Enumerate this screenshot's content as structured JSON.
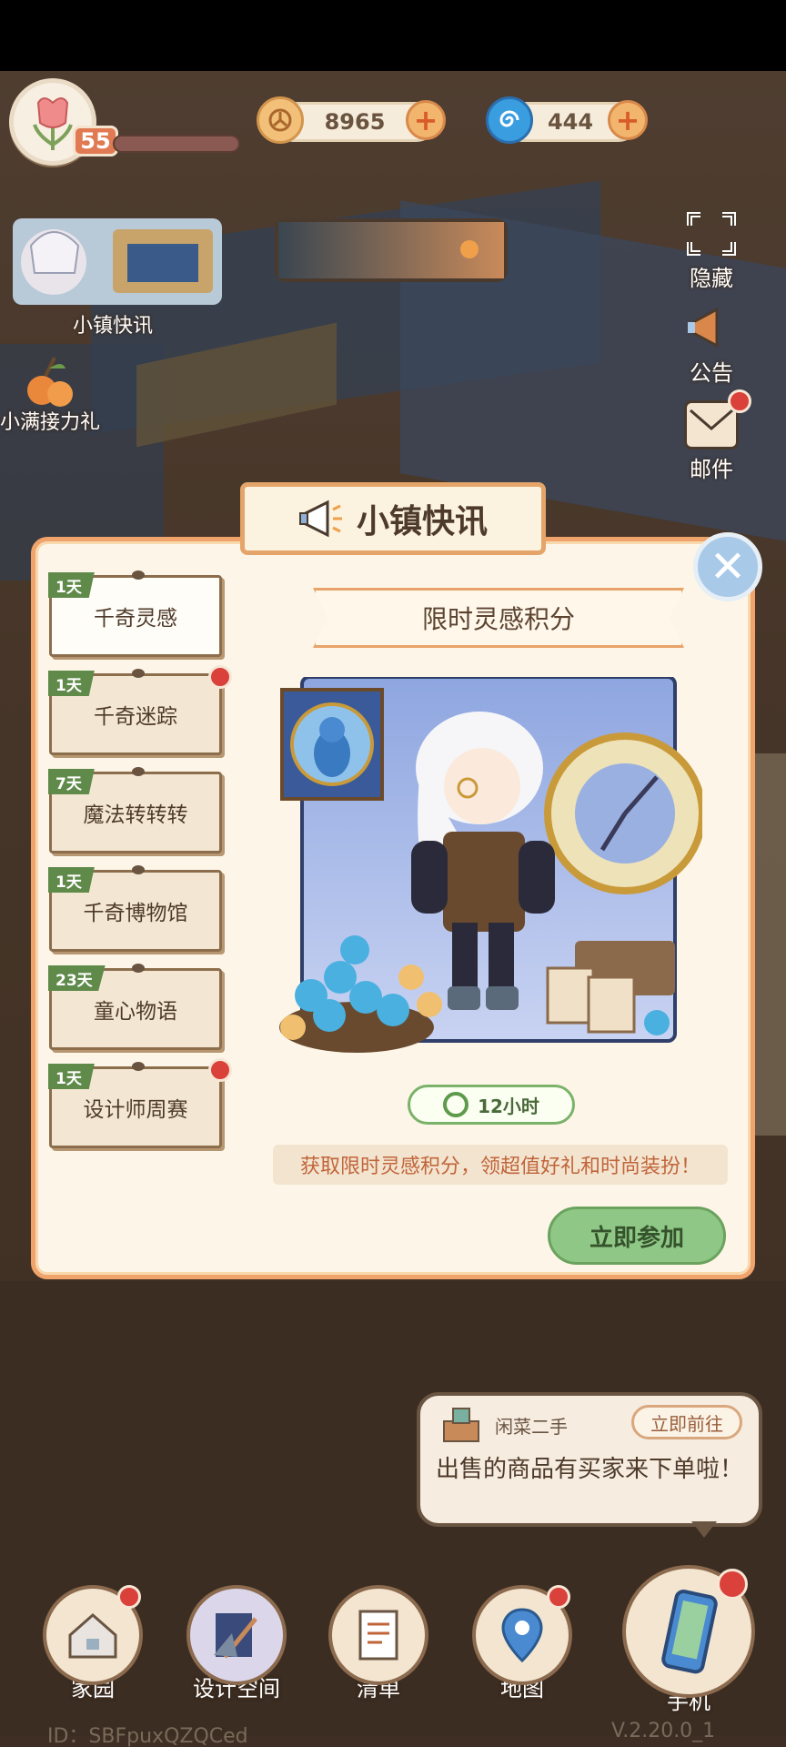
{
  "hud": {
    "level": "55",
    "coins": "8965",
    "gems": "444"
  },
  "left_shortcuts": {
    "news_label": "小镇快讯",
    "relay_label": "小满接力礼"
  },
  "right_rail": {
    "hide_label": "隐藏",
    "announce_label": "公告",
    "mail_label": "邮件"
  },
  "modal": {
    "title": "小镇快讯",
    "tabs": [
      {
        "days": "1天",
        "label": "千奇灵感",
        "active": true,
        "badge": false
      },
      {
        "days": "1天",
        "label": "千奇迷踪",
        "active": false,
        "badge": true
      },
      {
        "days": "7天",
        "label": "魔法转转转",
        "active": false,
        "badge": false
      },
      {
        "days": "1天",
        "label": "千奇博物馆",
        "active": false,
        "badge": false
      },
      {
        "days": "23天",
        "label": "童心物语",
        "active": false,
        "badge": false
      },
      {
        "days": "1天",
        "label": "设计师周赛",
        "active": false,
        "badge": true
      }
    ],
    "section_title": "限时灵感积分",
    "timer": "12小时",
    "description": "获取限时灵感积分，领超值好礼和时尚装扮！",
    "join_label": "立即参加"
  },
  "notification": {
    "app": "闲菜二手",
    "go_label": "立即前往",
    "message": "出售的商品有买家来下单啦！"
  },
  "bottom_nav": [
    {
      "label": "家园",
      "badge": true
    },
    {
      "label": "设计空间",
      "badge": false
    },
    {
      "label": "清单",
      "badge": false
    },
    {
      "label": "地图",
      "badge": true
    },
    {
      "label": "手机",
      "badge": true
    }
  ],
  "footer": {
    "id": "ID：SBFpuxQZQCed",
    "version": "V.2.20.0_1"
  },
  "colors": {
    "modal_border": "#f0a36a",
    "tab_day_tag": "#5f8a4a",
    "join_button": "#8fc886",
    "badge_red": "#d9413a"
  }
}
